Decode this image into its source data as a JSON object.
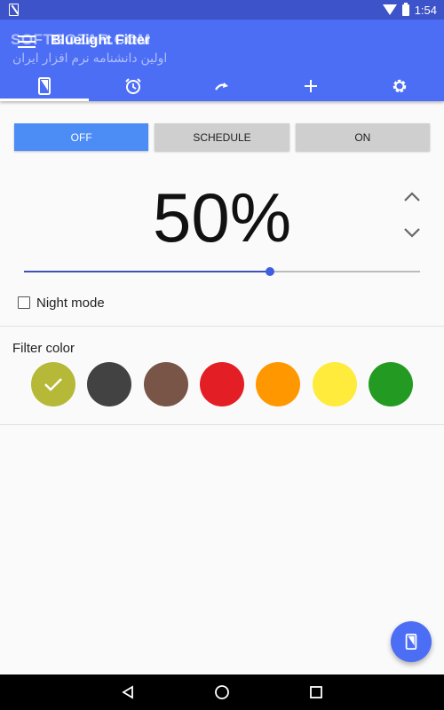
{
  "status_bar": {
    "time": "1:54"
  },
  "app_bar": {
    "title": "Bluelight Filter",
    "watermark": "SOFTGOZAR.COM",
    "watermark_sub": "اولین دانشنامه نرم افزار ایران"
  },
  "tabs": [
    {
      "icon": "phone-filter-icon",
      "active": true
    },
    {
      "icon": "alarm-clock-icon",
      "active": false
    },
    {
      "icon": "redo-arrow-icon",
      "active": false
    },
    {
      "icon": "plus-icon",
      "active": false
    },
    {
      "icon": "gear-icon",
      "active": false
    }
  ],
  "mode": {
    "off_label": "OFF",
    "schedule_label": "SCHEDULE",
    "on_label": "ON",
    "selected": "OFF"
  },
  "intensity": {
    "display": "50%",
    "value": 0.62
  },
  "night_mode": {
    "label": "Night mode",
    "checked": false
  },
  "filter_color": {
    "label": "Filter color",
    "selected": 0,
    "swatches": [
      "#b5b937",
      "#424242",
      "#795548",
      "#e31e24",
      "#ff9800",
      "#ffeb3b",
      "#239b23"
    ]
  },
  "colors": {
    "accent": "#4c6ef5",
    "status_bar": "#3c53c9",
    "mode_active": "#4b8cf5"
  }
}
